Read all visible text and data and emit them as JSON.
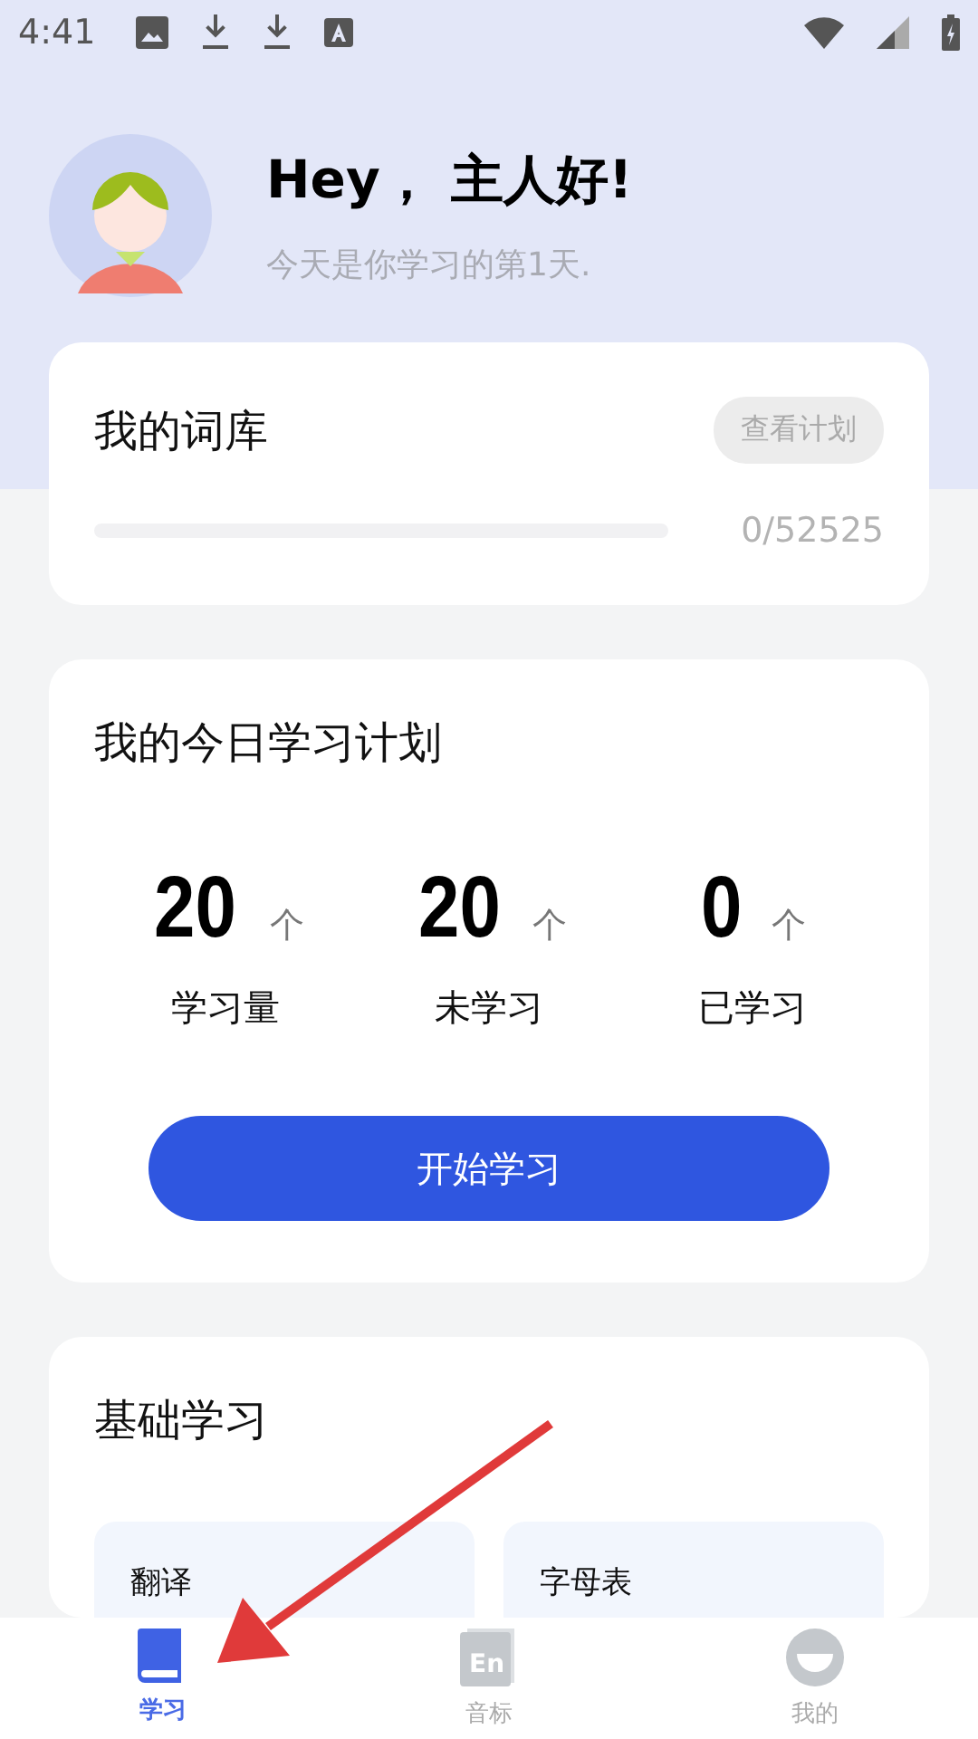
{
  "status_bar": {
    "time": "4:41"
  },
  "header": {
    "greeting": "Hey， 主人好!",
    "subtitle": "今天是你学习的第1天."
  },
  "word_bank": {
    "title": "我的词库",
    "button": "查看计划",
    "level": 0,
    "count": "0/52525"
  },
  "today_plan": {
    "title": "我的今日学习计划",
    "stats": [
      {
        "value": "20",
        "unit": "个",
        "label": "学习量"
      },
      {
        "value": "20",
        "unit": "个",
        "label": "未学习"
      },
      {
        "value": "0",
        "unit": "个",
        "label": "已学习"
      }
    ],
    "button": "开始学习"
  },
  "basics": {
    "title": "基础学习",
    "tiles": [
      {
        "label": "翻译"
      },
      {
        "label": "字母表"
      }
    ]
  },
  "nav": [
    {
      "label": "学习",
      "kind": "book",
      "selected": true
    },
    {
      "label": "音标",
      "kind": "en",
      "icon_text": "En",
      "selected": false
    },
    {
      "label": "我的",
      "kind": "face",
      "selected": false
    }
  ]
}
